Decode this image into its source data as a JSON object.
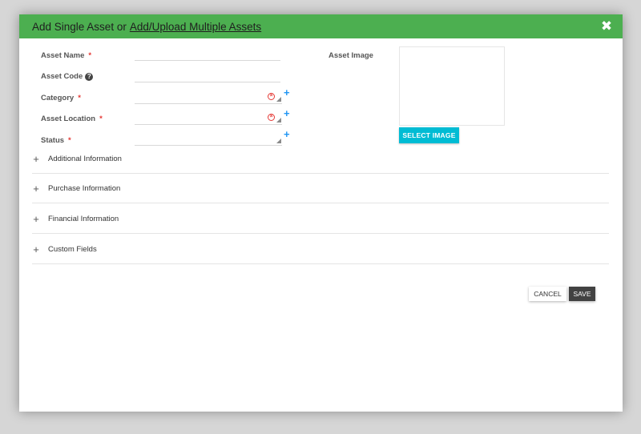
{
  "header": {
    "title_prefix": "Add Single Asset or",
    "title_link": "Add/Upload Multiple Assets"
  },
  "fields": {
    "asset_name": {
      "label": "Asset Name",
      "required": "*",
      "value": ""
    },
    "asset_code": {
      "label": "Asset Code",
      "help": "?",
      "value": ""
    },
    "category": {
      "label": "Category",
      "required": "*",
      "value": ""
    },
    "asset_location": {
      "label": "Asset Location",
      "required": "*",
      "value": ""
    },
    "status": {
      "label": "Status",
      "required": "*",
      "value": ""
    }
  },
  "image": {
    "label": "Asset Image",
    "button_label": "SELECT IMAGE"
  },
  "sections": [
    {
      "label": "Additional Information",
      "icon": "+"
    },
    {
      "label": "Purchase Information",
      "icon": "+"
    },
    {
      "label": "Financial Information",
      "icon": "+"
    },
    {
      "label": "Custom Fields",
      "icon": "+"
    }
  ],
  "footer": {
    "cancel_label": "CANCEL",
    "save_label": "SAVE"
  },
  "icons": {
    "close": "close-icon",
    "plus": "plus-icon",
    "clear": "clear-icon",
    "help": "help-icon",
    "expand": "expand-icon"
  },
  "colors": {
    "header_bg": "#4caf50",
    "accent_button": "#00bcd4",
    "save_button": "#424242",
    "required": "#e53935",
    "add_icon": "#2196f3"
  }
}
